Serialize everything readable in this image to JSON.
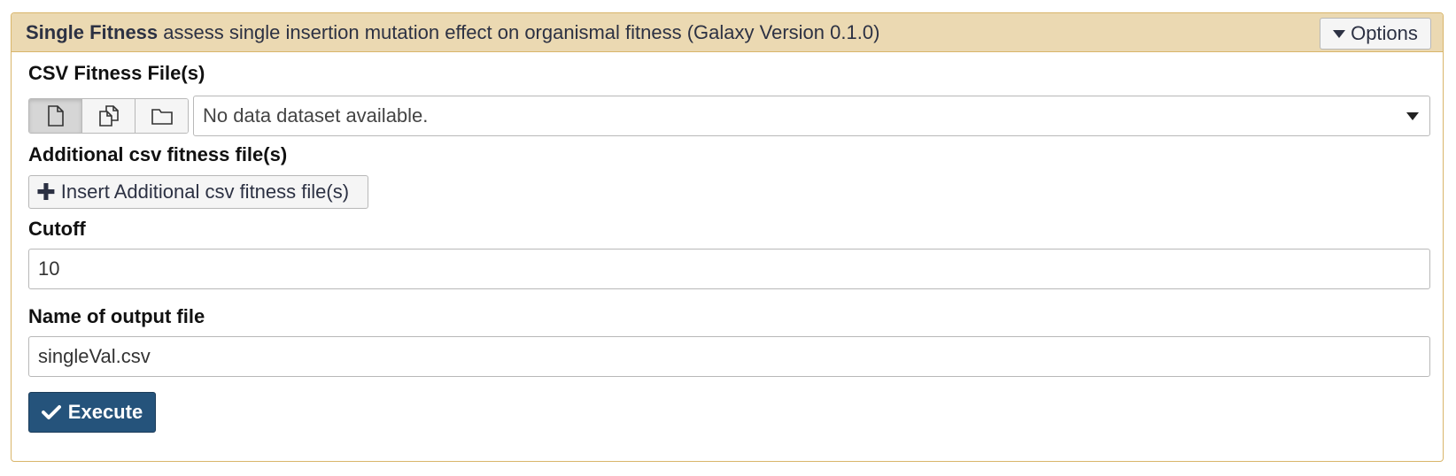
{
  "header": {
    "tool_name": "Single Fitness",
    "description": "assess single insertion mutation effect on organismal fitness (Galaxy Version 0.1.0)",
    "options_label": "Options"
  },
  "fields": {
    "csv_fitness": {
      "label": "CSV Fitness File(s)",
      "source_buttons": [
        "single-dataset",
        "multiple-datasets",
        "dataset-collection"
      ],
      "selected_value": "No data dataset available."
    },
    "additional": {
      "label": "Additional csv fitness file(s)",
      "insert_label": "Insert Additional csv fitness file(s)"
    },
    "cutoff": {
      "label": "Cutoff",
      "value": "10"
    },
    "output_name": {
      "label": "Name of output file",
      "value": "singleVal.csv"
    }
  },
  "execute": {
    "label": "Execute"
  },
  "colors": {
    "header_bg": "#ebd9b2",
    "border": "#d9b56a",
    "execute_bg": "#25537b"
  }
}
